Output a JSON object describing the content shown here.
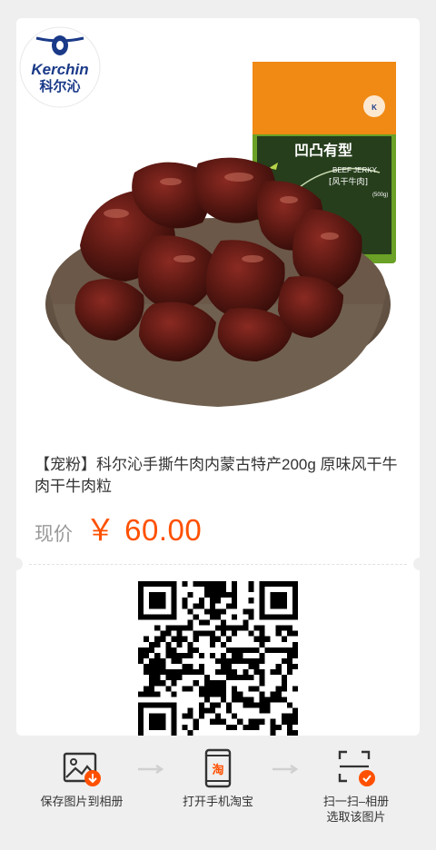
{
  "brand": {
    "logo_text_top": "Kerchin",
    "logo_text_bottom": "科尔沁"
  },
  "package": {
    "headline": "凹凸有型",
    "sub_en": "BEEF JERKY",
    "sub_cn": "[风干牛肉]",
    "weight": "(500g)"
  },
  "product": {
    "title": "【宠粉】科尔沁手撕牛肉内蒙古特产200g  原味风干牛肉干牛肉粒",
    "price_label": "现价",
    "price_value": "￥ 60.00"
  },
  "actions": [
    {
      "label": "保存图片到相册",
      "icon": "save-image-icon"
    },
    {
      "label": "打开手机淘宝",
      "icon": "taobao-phone-icon",
      "icon_glyph": "淘"
    },
    {
      "label_line1": "扫一扫–相册",
      "label_line2": "选取该图片",
      "icon": "scan-icon"
    }
  ],
  "colors": {
    "accent": "#ff5000",
    "background": "#efefef",
    "card": "#ffffff"
  }
}
